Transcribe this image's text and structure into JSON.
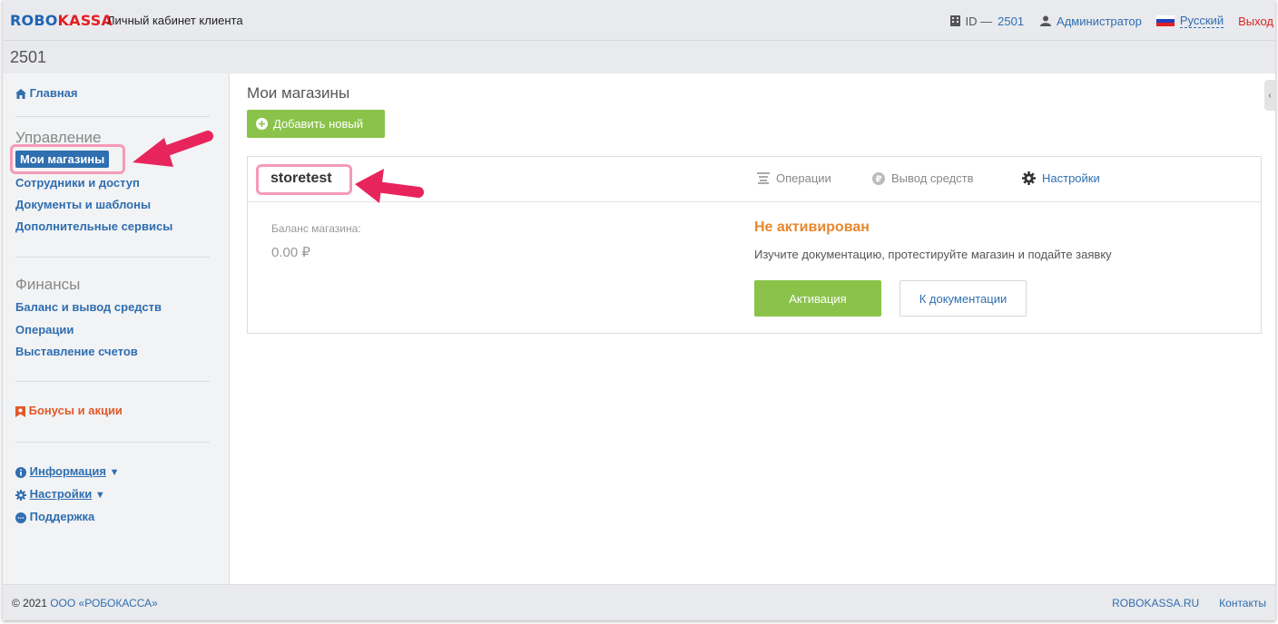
{
  "header": {
    "logo_part1": "ROBO",
    "logo_part2": "KASSA",
    "cabinet_label": "Личный кабинет клиента",
    "id_label": "ID —",
    "id_value": "2501",
    "user_label": "Администратор",
    "language_label": "Русский",
    "logout_label": "Выход"
  },
  "subheader": {
    "account_number": "2501"
  },
  "sidebar": {
    "home": "Главная",
    "management_heading": "Управление",
    "my_stores": "Мои магазины",
    "staff_access": "Сотрудники и доступ",
    "documents": "Документы и шаблоны",
    "extra_services": "Дополнительные сервисы",
    "finance_heading": "Финансы",
    "balance": "Баланс и вывод средств",
    "operations": "Операции",
    "invoicing": "Выставление счетов",
    "bonuses": "Бонусы и акции",
    "info": "Информация",
    "settings": "Настройки",
    "support": "Поддержка",
    "caret": "▼"
  },
  "main": {
    "title": "Мои магазины",
    "add_button": "Добавить новый",
    "store": {
      "name": "storetest",
      "tabs": {
        "operations": "Операции",
        "withdraw": "Вывод средств",
        "settings": "Настройки"
      },
      "balance_label": "Баланс магазина:",
      "balance_value": "0.00 ₽",
      "status": "Не активирован",
      "status_desc": "Изучите документацию, протестируйте магазин и подайте заявку",
      "activate_button": "Активация",
      "docs_button": "К документации"
    },
    "collapse_glyph": "‹"
  },
  "footer": {
    "copyright_prefix": "© 2021",
    "company": "ООО «РОБОКАССА»",
    "site_link": "ROBOKASSA.RU",
    "contacts_link": "Контакты"
  },
  "colors": {
    "brand_blue": "#1f64b4",
    "brand_red": "#e31e24",
    "link": "#2f6eb0",
    "green_button": "#8bc34a",
    "status_orange": "#e8872d",
    "annotation_pink": "#f59ab8",
    "annotation_arrow": "#e8245c"
  }
}
